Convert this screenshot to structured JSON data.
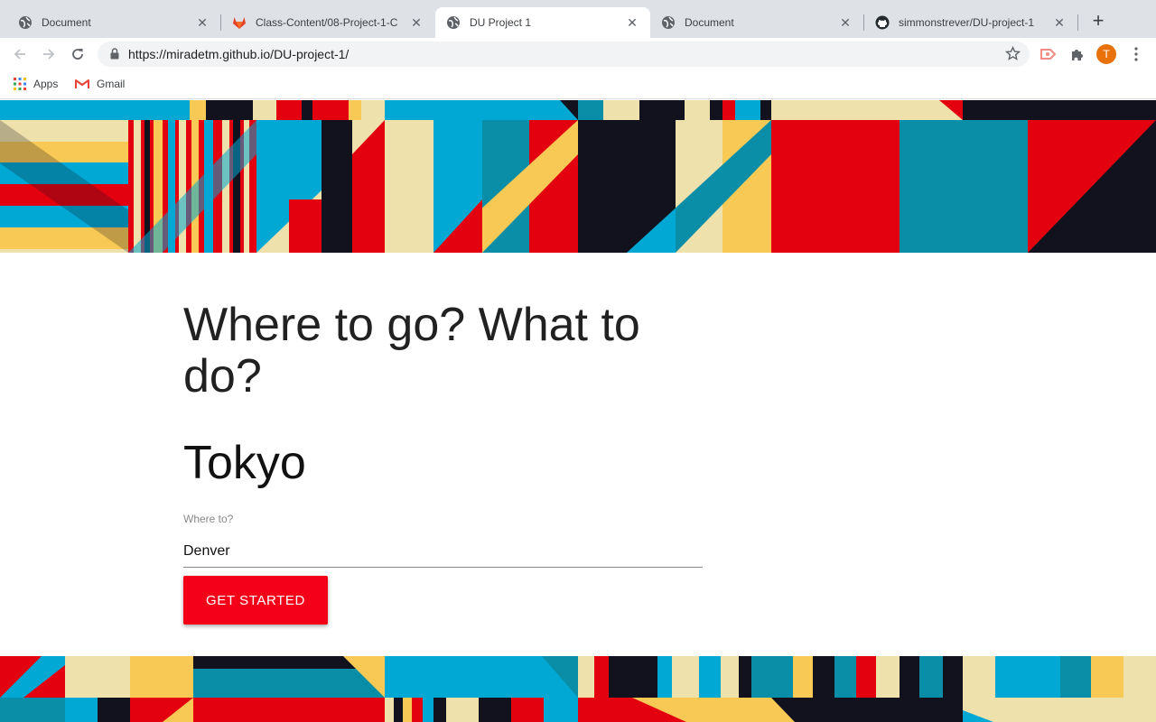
{
  "browser": {
    "tabs": [
      {
        "title": "Document",
        "icon": "globe-icon",
        "active": false
      },
      {
        "title": "Class-Content/08-Project-1-C",
        "icon": "gitlab-icon",
        "active": false
      },
      {
        "title": "DU Project 1",
        "icon": "globe-icon",
        "active": true
      },
      {
        "title": "Document",
        "icon": "globe-icon",
        "active": false
      },
      {
        "title": "simmonstrever/DU-project-1",
        "icon": "github-icon",
        "active": false
      }
    ],
    "new_tab": "+",
    "url": "https://miradetm.github.io/DU-project-1/",
    "profile_initial": "T",
    "profile_color": "#e8710a",
    "bookmarks": [
      {
        "label": "Apps",
        "icon": "apps-grid-icon"
      },
      {
        "label": "Gmail",
        "icon": "gmail-icon"
      }
    ]
  },
  "page": {
    "headline": "Where to go? What to do?",
    "city": "Tokyo",
    "input_label": "Where to?",
    "input_value": "Denver",
    "button_label": "GET STARTED",
    "accent_color": "#f40018"
  },
  "palette": {
    "cyan": "#00a8d3",
    "teal": "#0a8ea7",
    "red": "#e3000f",
    "yellow": "#f8c955",
    "cream": "#efe1ac",
    "navy": "#12121f"
  }
}
